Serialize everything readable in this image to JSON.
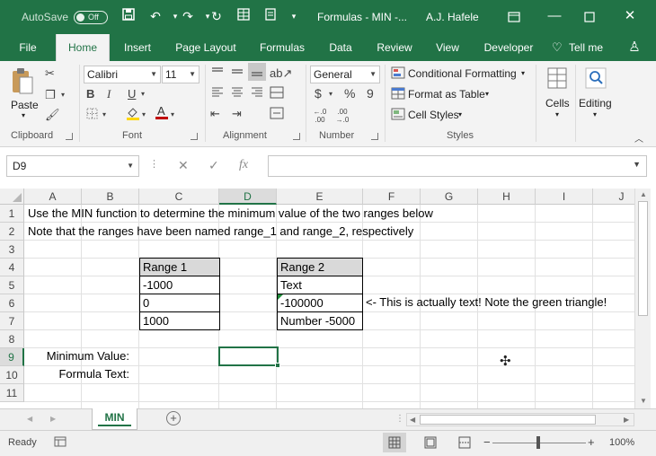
{
  "titlebar": {
    "autosave_label": "AutoSave",
    "autosave_state": "Off",
    "doc_title": "Formulas - MIN  -...",
    "user": "A.J. Hafele"
  },
  "tabs": [
    "File",
    "Home",
    "Insert",
    "Page Layout",
    "Formulas",
    "Data",
    "Review",
    "View",
    "Developer",
    "Tell me"
  ],
  "active_tab": "Home",
  "ribbon": {
    "clipboard": {
      "label": "Clipboard",
      "paste": "Paste"
    },
    "font": {
      "label": "Font",
      "name": "Calibri",
      "size": "11",
      "bold": "B",
      "italic": "I",
      "underline": "U"
    },
    "alignment": {
      "label": "Alignment"
    },
    "number": {
      "label": "Number",
      "format": "General",
      "currency": "$",
      "percent": "%",
      "comma": "9",
      "inc_dec": "←.0 .00",
      "dec_dec": ".00 →.0"
    },
    "styles": {
      "label": "Styles",
      "conditional": "Conditional Formatting",
      "format_table": "Format as Table",
      "cell_styles": "Cell Styles"
    },
    "cells": {
      "label": "Cells"
    },
    "editing": {
      "label": "Editing"
    }
  },
  "formula_bar": {
    "name_box": "D9",
    "formula": "",
    "fx": "fx"
  },
  "columns": [
    "A",
    "B",
    "C",
    "D",
    "E",
    "F",
    "G",
    "H",
    "I",
    "J"
  ],
  "rows": [
    "1",
    "2",
    "3",
    "4",
    "5",
    "6",
    "7",
    "8",
    "9",
    "10",
    "11"
  ],
  "selected_column": "D",
  "selected_row": "9",
  "cells": {
    "A1": "Use the MIN function to determine the minimum value of the two ranges below",
    "A2": "Note that the ranges have been named range_1 and range_2, respectively",
    "C4": "Range 1",
    "C5": "-1000",
    "C6": "0",
    "C7": "1000",
    "E4": "Range 2",
    "E5": "Text",
    "E6": "-100000",
    "E7": "Number -5000",
    "F6": "<- This is actually text!  Note the green triangle!",
    "B9": "Minimum Value:",
    "B10": "Formula Text:"
  },
  "sheet_tab": "MIN",
  "status": {
    "ready": "Ready",
    "zoom": "100%"
  },
  "colors": {
    "accent": "#217346",
    "error_triangle": "#1e8c3a"
  }
}
